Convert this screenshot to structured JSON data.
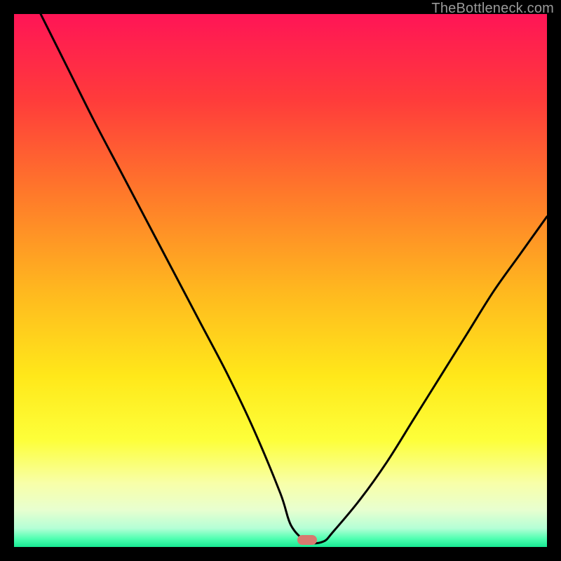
{
  "attribution": "TheBottleneck.com",
  "marker": {
    "x_pct": 55.0,
    "y_pct": 98.7,
    "color": "#d87a6f"
  },
  "gradient_stops": [
    {
      "offset": 0,
      "color": "#ff1556"
    },
    {
      "offset": 0.16,
      "color": "#ff3b3b"
    },
    {
      "offset": 0.34,
      "color": "#ff7a2a"
    },
    {
      "offset": 0.52,
      "color": "#ffb81f"
    },
    {
      "offset": 0.68,
      "color": "#ffe81a"
    },
    {
      "offset": 0.8,
      "color": "#fdff3a"
    },
    {
      "offset": 0.88,
      "color": "#f8ffa8"
    },
    {
      "offset": 0.93,
      "color": "#e8ffcf"
    },
    {
      "offset": 0.965,
      "color": "#b4ffd6"
    },
    {
      "offset": 0.985,
      "color": "#4dffb0"
    },
    {
      "offset": 1.0,
      "color": "#18e893"
    }
  ],
  "chart_data": {
    "type": "line",
    "title": "",
    "xlabel": "",
    "ylabel": "",
    "xlim": [
      0,
      100
    ],
    "ylim": [
      0,
      100
    ],
    "series": [
      {
        "name": "bottleneck-curve",
        "x": [
          5,
          10,
          15,
          20,
          25,
          30,
          35,
          40,
          45,
          50,
          52,
          55,
          58,
          60,
          65,
          70,
          75,
          80,
          85,
          90,
          95,
          100
        ],
        "y": [
          100,
          90,
          80,
          70.5,
          61,
          51.5,
          42,
          32.5,
          22,
          10,
          4,
          1,
          1,
          3,
          9,
          16,
          24,
          32,
          40,
          48,
          55,
          62
        ]
      }
    ],
    "annotation": {
      "marker_x": 55,
      "marker_y": 1.3
    }
  }
}
